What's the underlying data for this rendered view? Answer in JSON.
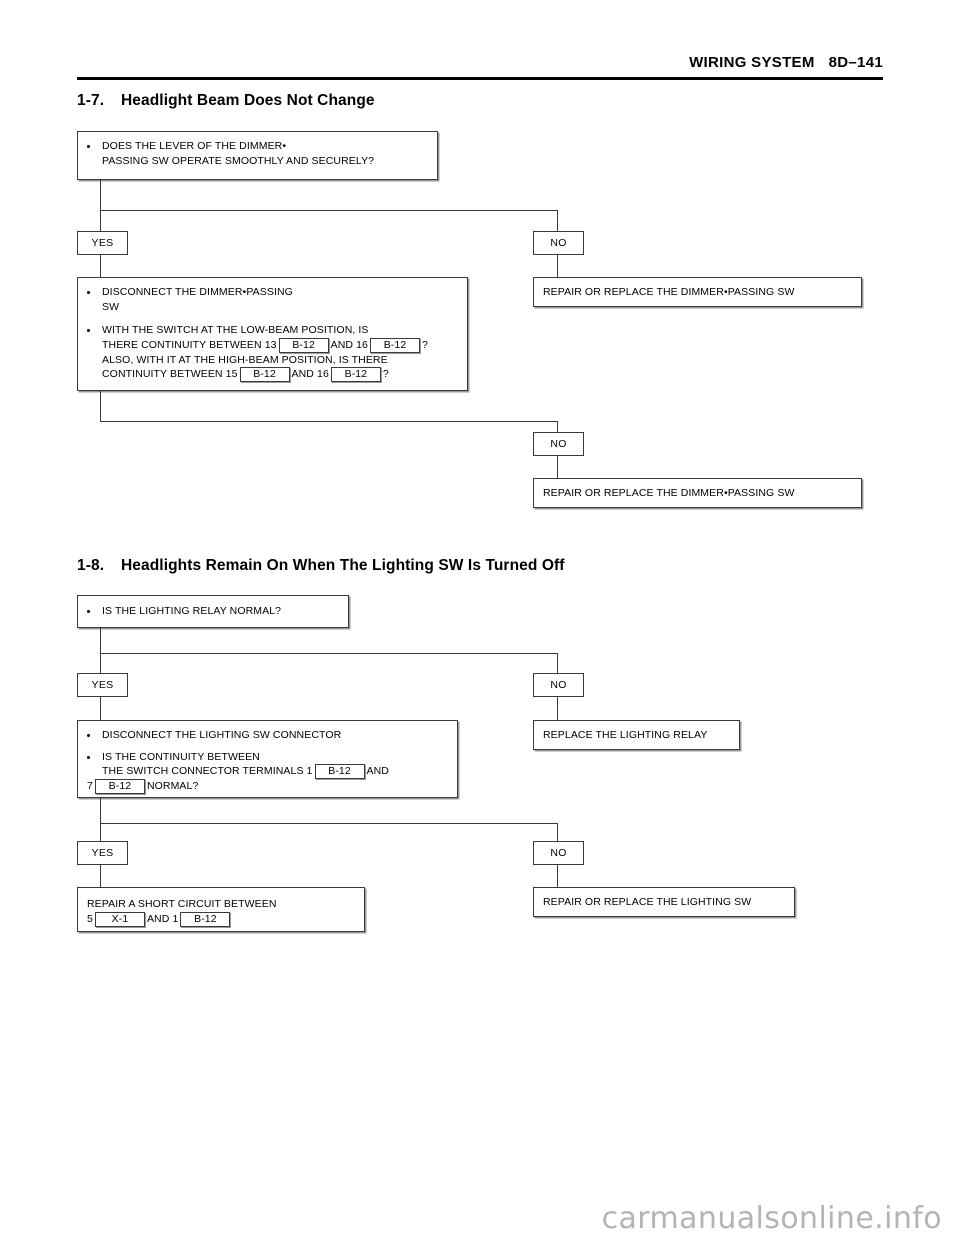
{
  "header": {
    "title": "WIRING SYSTEM",
    "page_number": "8D–141"
  },
  "sections": [
    {
      "number": "1-7.",
      "title": "Headlight Beam Does Not Change",
      "nodes": {
        "question1": {
          "bullet1_line1": "DOES THE LEVER OF THE DIMMER•",
          "bullet1_line2": "PASSING SW OPERATE SMOOTHLY AND SECURELY?"
        },
        "branch1_yes": "YES",
        "branch1_no": "NO",
        "result_no1": "REPAIR OR REPLACE THE DIMMER•PASSING SW",
        "question2": {
          "bullet1_line1": "DISCONNECT THE DIMMER•PASSING",
          "bullet1_line2": "SW",
          "bullet2_line1": "WITH THE SWITCH AT THE LOW-BEAM POSITION, IS",
          "bullet2_line2_a": "THERE CONTINUITY BETWEEN 13",
          "bullet2_line2_conn1": "B-12",
          "bullet2_line2_b": "AND 16",
          "bullet2_line2_conn2": "B-12",
          "bullet2_line2_c": "?",
          "bullet2_line3": "ALSO, WITH IT AT THE HIGH-BEAM POSITION, IS THERE",
          "bullet2_line4_a": "CONTINUITY BETWEEN 15",
          "bullet2_line4_conn1": "B-12",
          "bullet2_line4_b": "AND 16",
          "bullet2_line4_conn2": "B-12",
          "bullet2_line4_c": "?"
        },
        "branch2_no": "NO",
        "result_no2": "REPAIR OR REPLACE THE DIMMER•PASSING SW"
      }
    },
    {
      "number": "1-8.",
      "title": "Headlights Remain On When The Lighting SW Is Turned Off",
      "nodes": {
        "question1": {
          "bullet1_line1": "IS THE LIGHTING RELAY NORMAL?"
        },
        "branch1_yes": "YES",
        "branch1_no": "NO",
        "result_no1": "REPLACE THE LIGHTING RELAY",
        "question2": {
          "bullet1_line1": "DISCONNECT THE LIGHTING SW CONNECTOR",
          "bullet2_line1": "IS THE CONTINUITY BETWEEN",
          "bullet2_line2_a": "THE SWITCH CONNECTOR TERMINALS 1",
          "bullet2_line2_conn1": "B-12",
          "bullet2_line2_b": "AND",
          "bullet2_line3_a": "7",
          "bullet2_line3_conn1": "B-12",
          "bullet2_line3_b": "NORMAL?"
        },
        "branch2_yes": "YES",
        "branch2_no": "NO",
        "result_yes2_line1": "REPAIR A SHORT CIRCUIT BETWEEN",
        "result_yes2_line2_a": "5",
        "result_yes2_conn1": "X-1",
        "result_yes2_line2_b": "AND 1",
        "result_yes2_conn2": "B-12",
        "result_no2": "REPAIR OR REPLACE THE LIGHTING SW"
      }
    }
  ],
  "watermark": "carmanualsonline.info"
}
